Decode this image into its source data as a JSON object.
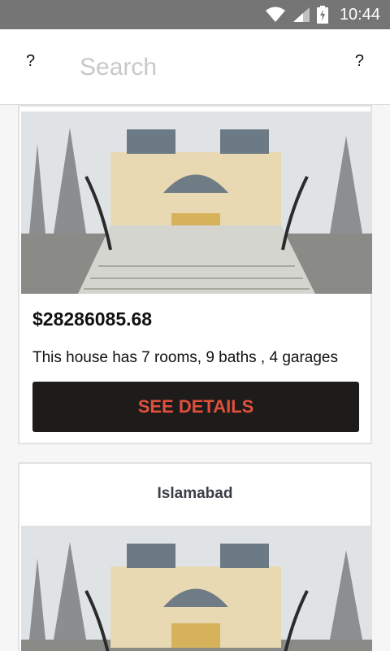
{
  "status_bar": {
    "time": "10:44",
    "icons": [
      "wifi-icon",
      "signal-icon",
      "battery-charging-icon"
    ]
  },
  "app_bar": {
    "left_icon": "?",
    "right_icon": "?",
    "search_placeholder": "Search"
  },
  "listings": [
    {
      "price": "$28286085.68",
      "description": "This house has 7 rooms, 9 baths , 4 garages",
      "button_label": "SEE DETAILS"
    },
    {
      "city": "Islamabad"
    }
  ],
  "colors": {
    "status_bar_bg": "#757575",
    "button_bg": "#1e1b1b",
    "button_text": "#e0503b",
    "placeholder": "#c8c8c8"
  }
}
